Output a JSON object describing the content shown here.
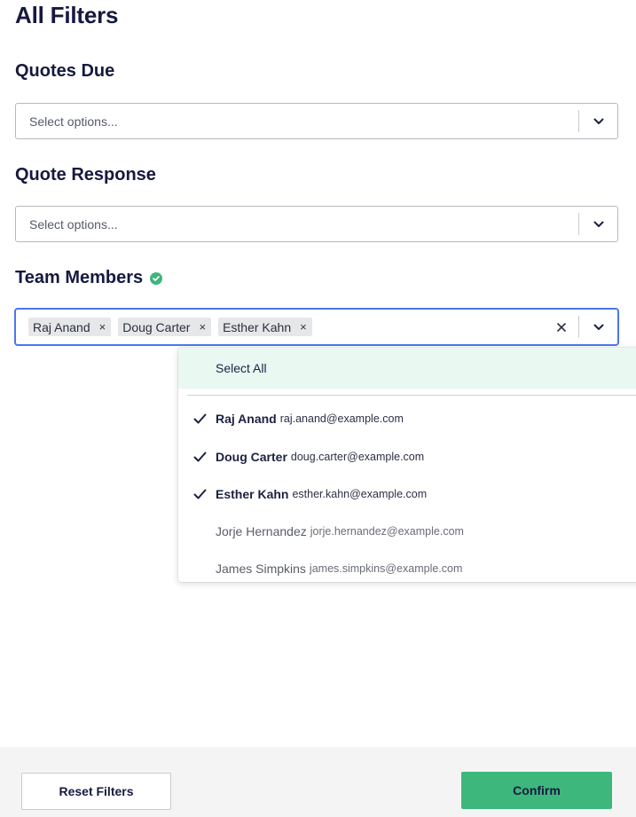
{
  "page": {
    "title": "All Filters"
  },
  "quotes_due": {
    "label": "Quotes Due",
    "placeholder": "Select options..."
  },
  "quote_response": {
    "label": "Quote Response",
    "placeholder": "Select options..."
  },
  "team_members": {
    "label": "Team Members",
    "selected_chips": [
      "Raj Anand",
      "Doug Carter",
      "Esther Kahn"
    ],
    "chip_remove_glyph": "×",
    "clear_glyph": "✕",
    "dropdown": {
      "select_all_label": "Select All",
      "options": [
        {
          "name": "Raj Anand",
          "email": "raj.anand@example.com",
          "selected": true
        },
        {
          "name": "Doug Carter",
          "email": "doug.carter@example.com",
          "selected": true
        },
        {
          "name": "Esther Kahn",
          "email": "esther.kahn@example.com",
          "selected": true
        },
        {
          "name": "Jorje Hernandez",
          "email": "jorje.hernandez@example.com",
          "selected": false
        },
        {
          "name": "James Simpkins",
          "email": "james.simpkins@example.com",
          "selected": false
        }
      ]
    }
  },
  "footer": {
    "reset_label": "Reset Filters",
    "confirm_label": "Confirm"
  },
  "colors": {
    "accent_green": "#3eb77c",
    "focus_blue": "#4a77ee",
    "heading": "#16193f"
  },
  "icons": {
    "chevron": "chevron-down-icon",
    "check": "check-icon",
    "badge": "check-circle-icon"
  }
}
